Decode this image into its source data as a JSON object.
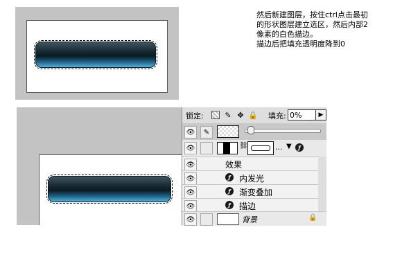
{
  "instructions": [
    "然后新建图层，按住ctrl点击最初",
    "的形状图层建立选区，然后内部2",
    "像素的白色描边。",
    "描边后把填充透明度降到0"
  ],
  "layers_panel": {
    "lock_label": "锁定:",
    "fill_label": "填充:",
    "fill_value": "0%",
    "shape_layer_dots": "...",
    "effects_label": "效果",
    "effects": [
      "内发光",
      "渐变叠加",
      "描边"
    ],
    "background_label": "背景"
  },
  "icons": {
    "eye": "eye-icon",
    "brush": "brush-icon",
    "move": "move-icon",
    "lock": "lock-icon",
    "fx": "fx-icon",
    "chain": "chain-icon"
  },
  "colors": {
    "canvas_bg": "#c3c3c3",
    "pill_dark": "#0b1a22",
    "pill_light": "#4db3e0"
  }
}
